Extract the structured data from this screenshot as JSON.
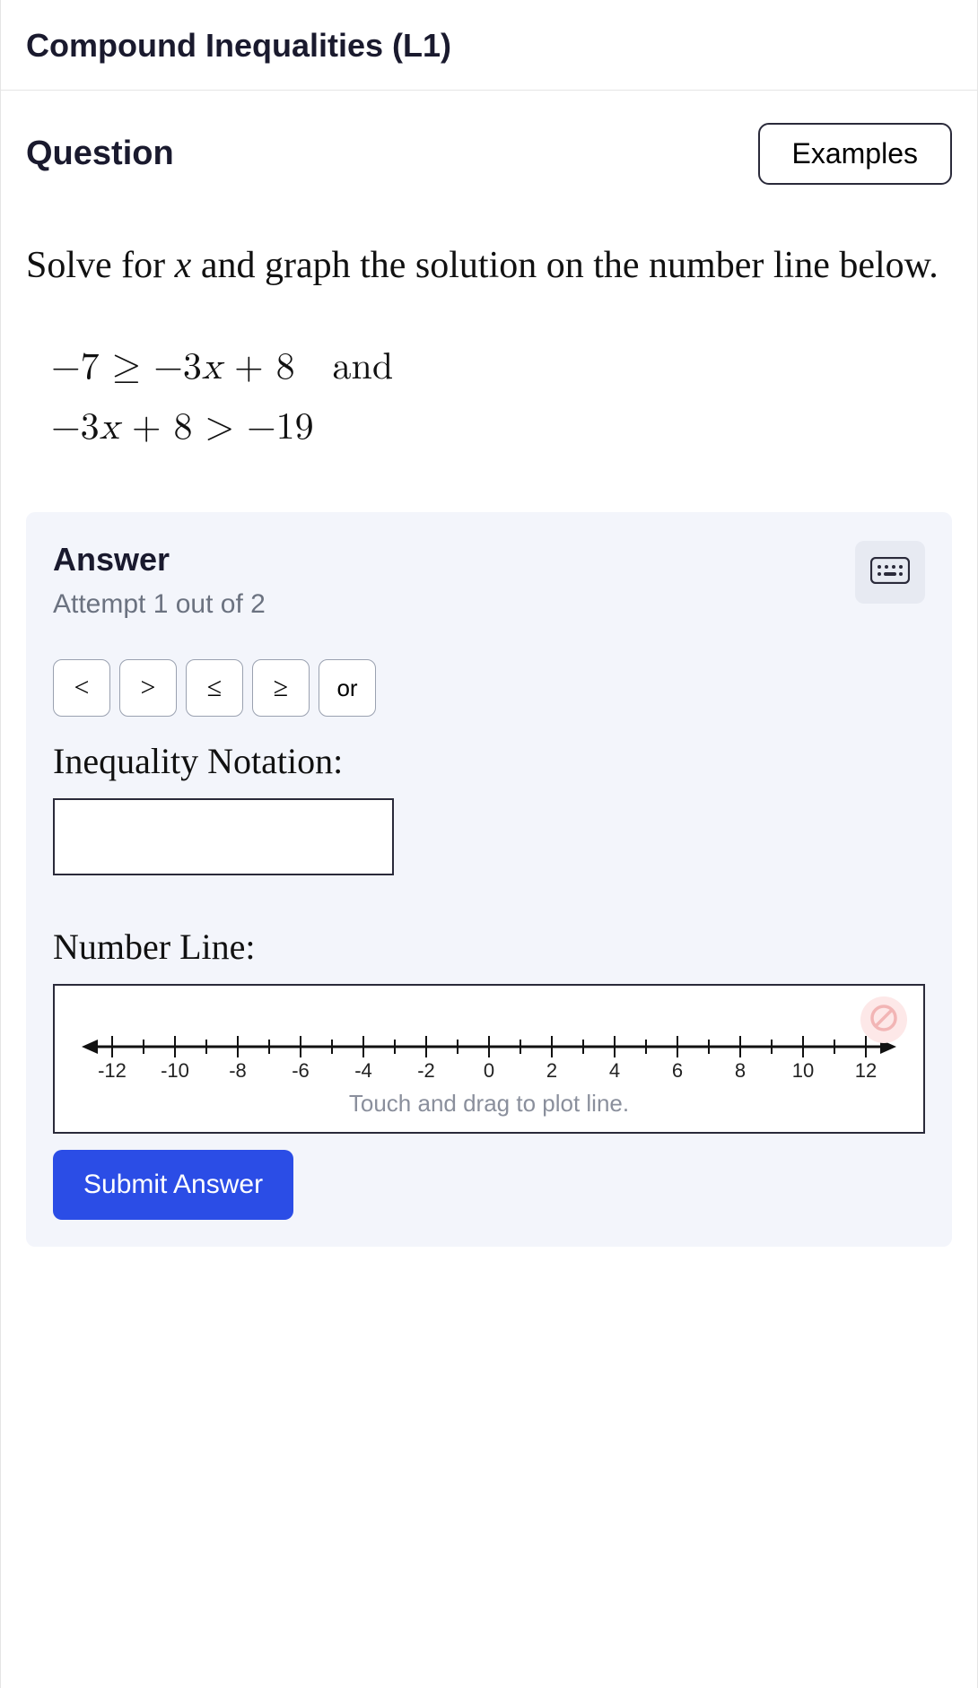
{
  "header": {
    "title": "Compound Inequalities (L1)"
  },
  "question": {
    "label": "Question",
    "examples_btn": "Examples",
    "prompt_pre": "Solve for ",
    "prompt_var": "x",
    "prompt_post": " and graph the solution on the number line below.",
    "eq1": "−7 ≥ −3x + 8   and",
    "eq2": "−3x + 8 > −19"
  },
  "answer": {
    "title": "Answer",
    "attempt": "Attempt 1 out of 2",
    "ops": {
      "lt": "<",
      "gt": ">",
      "le": "≤",
      "ge": "≥",
      "or": "or"
    },
    "notation_label": "Inequality Notation:",
    "notation_value": "",
    "numberline_label": "Number Line:",
    "ticks": [
      "-12",
      "-10",
      "-8",
      "-6",
      "-4",
      "-2",
      "0",
      "2",
      "4",
      "6",
      "8",
      "10",
      "12"
    ],
    "hint": "Touch and drag to plot line.",
    "submit": "Submit Answer"
  }
}
